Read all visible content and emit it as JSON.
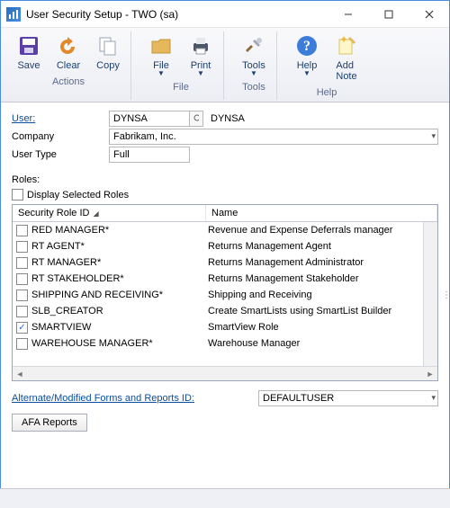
{
  "window": {
    "title": "User Security Setup  -  TWO (sa)"
  },
  "ribbon": {
    "actions": {
      "save": "Save",
      "clear": "Clear",
      "copy": "Copy",
      "group": "Actions"
    },
    "file": {
      "file": "File",
      "print": "Print",
      "group": "File"
    },
    "tools": {
      "tools": "Tools",
      "group": "Tools"
    },
    "help": {
      "help": "Help",
      "addnote": "Add Note",
      "group": "Help"
    }
  },
  "form": {
    "user_label": "User:",
    "user_id": "DYNSA",
    "user_name": "DYNSA",
    "company_label": "Company",
    "company_value": "Fabrikam, Inc.",
    "usertype_label": "User Type",
    "usertype_value": "Full"
  },
  "roles": {
    "heading": "Roles:",
    "display_selected": "Display Selected Roles",
    "col_id": "Security Role ID",
    "col_name": "Name",
    "rows": [
      {
        "id": "RED MANAGER*",
        "name": "Revenue and Expense Deferrals manager",
        "checked": false
      },
      {
        "id": "RT AGENT*",
        "name": "Returns Management Agent",
        "checked": false
      },
      {
        "id": "RT MANAGER*",
        "name": "Returns Management Administrator",
        "checked": false
      },
      {
        "id": "RT STAKEHOLDER*",
        "name": "Returns Management Stakeholder",
        "checked": false
      },
      {
        "id": "SHIPPING AND RECEIVING*",
        "name": "Shipping and Receiving",
        "checked": false
      },
      {
        "id": "SLB_CREATOR",
        "name": "Create SmartLists using SmartList Builder",
        "checked": false
      },
      {
        "id": "SMARTVIEW",
        "name": "SmartView Role",
        "checked": true
      },
      {
        "id": "WAREHOUSE MANAGER*",
        "name": "Warehouse Manager",
        "checked": false
      }
    ]
  },
  "bottom": {
    "altmod_label": "Alternate/Modified Forms and Reports ID:",
    "altmod_value": "DEFAULTUSER",
    "afa_button": "AFA Reports"
  }
}
